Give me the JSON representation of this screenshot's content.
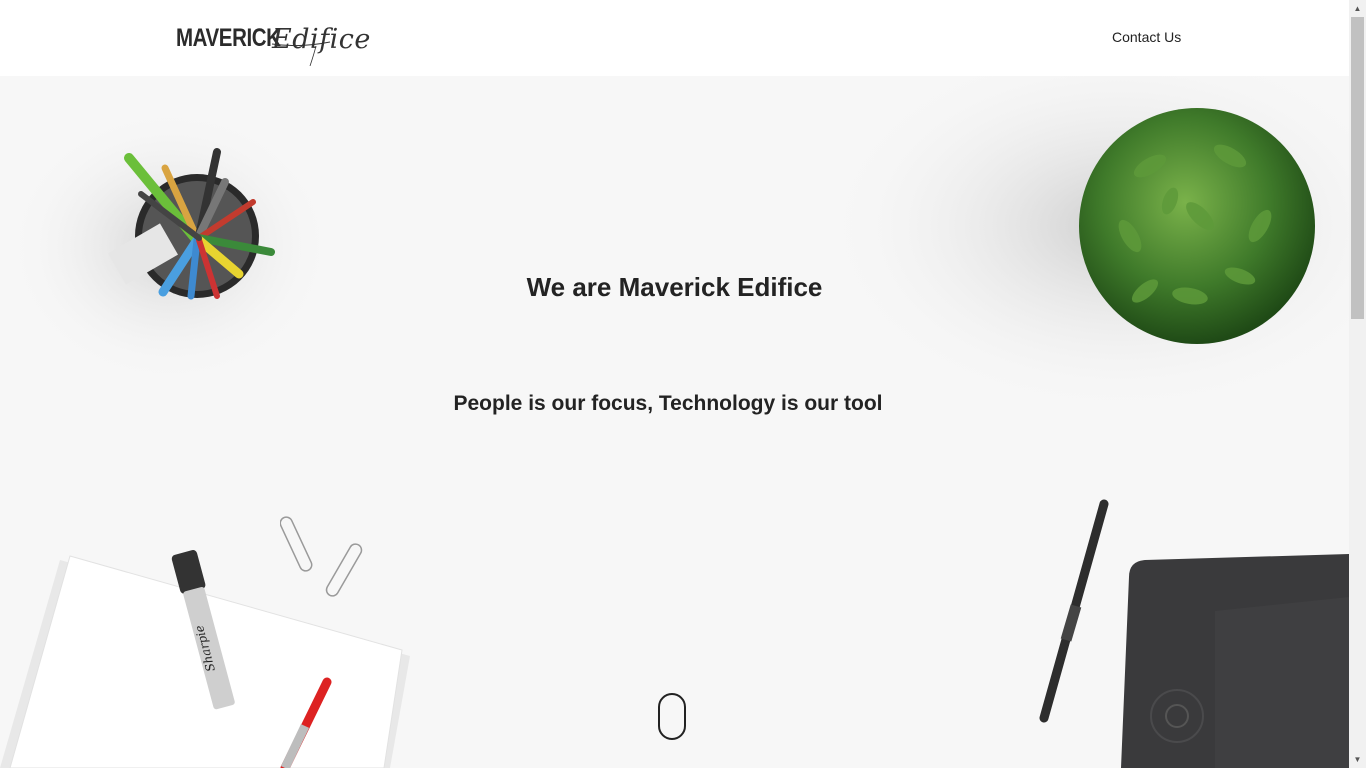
{
  "header": {
    "logo_main": "MAVERICK",
    "logo_script": "Edifice",
    "nav_contact": "Contact Us"
  },
  "hero": {
    "title": "We are Maverick Edifice",
    "subtitle": "People is our focus, Technology is our tool"
  },
  "decor": {
    "marker_brand": "Sharpie"
  },
  "colors": {
    "background": "#f7f7f7",
    "header_bg": "#ffffff",
    "text": "#232323",
    "plant_green": "#3f7a2a",
    "tablet_dark": "#3a3a3c"
  },
  "icons": [
    "scroll-down-mouse-icon",
    "pen-cup-icon",
    "plant-icon",
    "paper-stack-icon",
    "marker-icon",
    "paperclip-icon",
    "stylus-icon",
    "drawing-tablet-icon"
  ]
}
